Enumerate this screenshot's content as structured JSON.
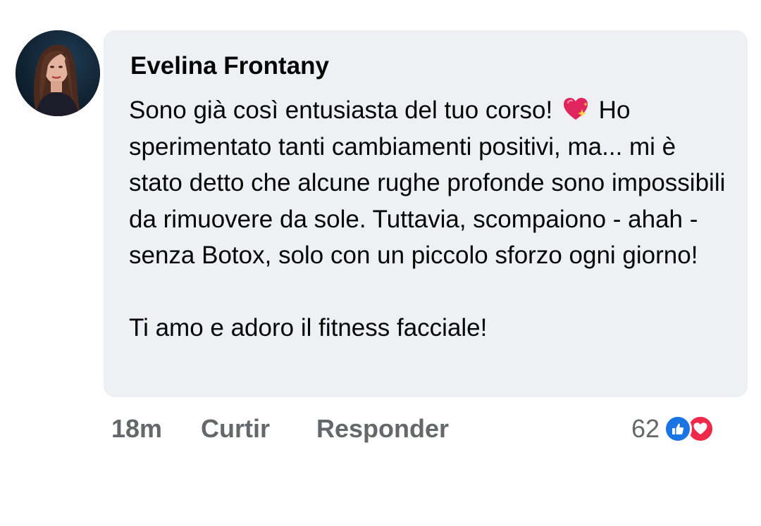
{
  "comment": {
    "author": "Evelina Frontany",
    "text_line1_before_emoji": "Sono già così entusiasta del tuo corso!",
    "emoji": "sparkling-heart-icon",
    "text_line1_after_emoji": "Ho sperimentato tanti cambiamenti positivi, ma... mi è stato detto che alcune rughe profonde sono impossibili da rimuovere da sole. Tuttavia, scompaiono - ahah - senza Botox, solo con un piccolo sforzo ogni giorno!",
    "text_paragraph2": "Ti amo e adoro il fitness facciale!"
  },
  "actions": {
    "time": "18m",
    "like_label": "Curtir",
    "reply_label": "Responder"
  },
  "reactions": {
    "count": "62",
    "icons": [
      "like-reaction-icon",
      "love-reaction-icon"
    ]
  },
  "colors": {
    "bubble_bg": "#eff0f3",
    "action_text": "#65676b",
    "like_blue": "#1a74e4",
    "love_red": "#f0284a"
  }
}
